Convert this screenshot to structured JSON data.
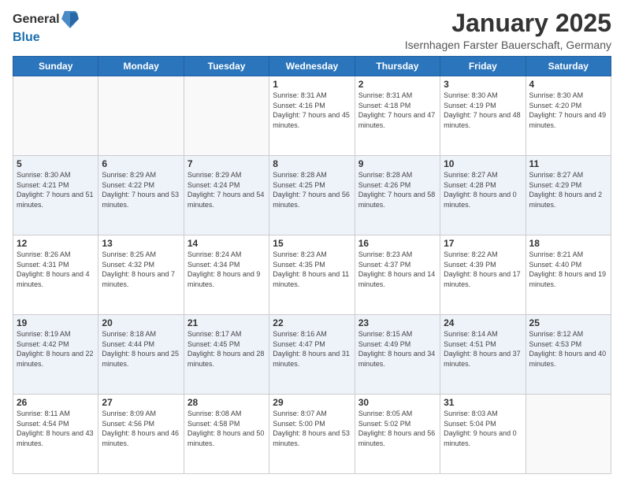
{
  "header": {
    "logo_general": "General",
    "logo_blue": "Blue",
    "month_title": "January 2025",
    "location": "Isernhagen Farster Bauerschaft, Germany"
  },
  "days_of_week": [
    "Sunday",
    "Monday",
    "Tuesday",
    "Wednesday",
    "Thursday",
    "Friday",
    "Saturday"
  ],
  "weeks": [
    [
      {
        "day": "",
        "info": ""
      },
      {
        "day": "",
        "info": ""
      },
      {
        "day": "",
        "info": ""
      },
      {
        "day": "1",
        "info": "Sunrise: 8:31 AM\nSunset: 4:16 PM\nDaylight: 7 hours and 45 minutes."
      },
      {
        "day": "2",
        "info": "Sunrise: 8:31 AM\nSunset: 4:18 PM\nDaylight: 7 hours and 47 minutes."
      },
      {
        "day": "3",
        "info": "Sunrise: 8:30 AM\nSunset: 4:19 PM\nDaylight: 7 hours and 48 minutes."
      },
      {
        "day": "4",
        "info": "Sunrise: 8:30 AM\nSunset: 4:20 PM\nDaylight: 7 hours and 49 minutes."
      }
    ],
    [
      {
        "day": "5",
        "info": "Sunrise: 8:30 AM\nSunset: 4:21 PM\nDaylight: 7 hours and 51 minutes."
      },
      {
        "day": "6",
        "info": "Sunrise: 8:29 AM\nSunset: 4:22 PM\nDaylight: 7 hours and 53 minutes."
      },
      {
        "day": "7",
        "info": "Sunrise: 8:29 AM\nSunset: 4:24 PM\nDaylight: 7 hours and 54 minutes."
      },
      {
        "day": "8",
        "info": "Sunrise: 8:28 AM\nSunset: 4:25 PM\nDaylight: 7 hours and 56 minutes."
      },
      {
        "day": "9",
        "info": "Sunrise: 8:28 AM\nSunset: 4:26 PM\nDaylight: 7 hours and 58 minutes."
      },
      {
        "day": "10",
        "info": "Sunrise: 8:27 AM\nSunset: 4:28 PM\nDaylight: 8 hours and 0 minutes."
      },
      {
        "day": "11",
        "info": "Sunrise: 8:27 AM\nSunset: 4:29 PM\nDaylight: 8 hours and 2 minutes."
      }
    ],
    [
      {
        "day": "12",
        "info": "Sunrise: 8:26 AM\nSunset: 4:31 PM\nDaylight: 8 hours and 4 minutes."
      },
      {
        "day": "13",
        "info": "Sunrise: 8:25 AM\nSunset: 4:32 PM\nDaylight: 8 hours and 7 minutes."
      },
      {
        "day": "14",
        "info": "Sunrise: 8:24 AM\nSunset: 4:34 PM\nDaylight: 8 hours and 9 minutes."
      },
      {
        "day": "15",
        "info": "Sunrise: 8:23 AM\nSunset: 4:35 PM\nDaylight: 8 hours and 11 minutes."
      },
      {
        "day": "16",
        "info": "Sunrise: 8:23 AM\nSunset: 4:37 PM\nDaylight: 8 hours and 14 minutes."
      },
      {
        "day": "17",
        "info": "Sunrise: 8:22 AM\nSunset: 4:39 PM\nDaylight: 8 hours and 17 minutes."
      },
      {
        "day": "18",
        "info": "Sunrise: 8:21 AM\nSunset: 4:40 PM\nDaylight: 8 hours and 19 minutes."
      }
    ],
    [
      {
        "day": "19",
        "info": "Sunrise: 8:19 AM\nSunset: 4:42 PM\nDaylight: 8 hours and 22 minutes."
      },
      {
        "day": "20",
        "info": "Sunrise: 8:18 AM\nSunset: 4:44 PM\nDaylight: 8 hours and 25 minutes."
      },
      {
        "day": "21",
        "info": "Sunrise: 8:17 AM\nSunset: 4:45 PM\nDaylight: 8 hours and 28 minutes."
      },
      {
        "day": "22",
        "info": "Sunrise: 8:16 AM\nSunset: 4:47 PM\nDaylight: 8 hours and 31 minutes."
      },
      {
        "day": "23",
        "info": "Sunrise: 8:15 AM\nSunset: 4:49 PM\nDaylight: 8 hours and 34 minutes."
      },
      {
        "day": "24",
        "info": "Sunrise: 8:14 AM\nSunset: 4:51 PM\nDaylight: 8 hours and 37 minutes."
      },
      {
        "day": "25",
        "info": "Sunrise: 8:12 AM\nSunset: 4:53 PM\nDaylight: 8 hours and 40 minutes."
      }
    ],
    [
      {
        "day": "26",
        "info": "Sunrise: 8:11 AM\nSunset: 4:54 PM\nDaylight: 8 hours and 43 minutes."
      },
      {
        "day": "27",
        "info": "Sunrise: 8:09 AM\nSunset: 4:56 PM\nDaylight: 8 hours and 46 minutes."
      },
      {
        "day": "28",
        "info": "Sunrise: 8:08 AM\nSunset: 4:58 PM\nDaylight: 8 hours and 50 minutes."
      },
      {
        "day": "29",
        "info": "Sunrise: 8:07 AM\nSunset: 5:00 PM\nDaylight: 8 hours and 53 minutes."
      },
      {
        "day": "30",
        "info": "Sunrise: 8:05 AM\nSunset: 5:02 PM\nDaylight: 8 hours and 56 minutes."
      },
      {
        "day": "31",
        "info": "Sunrise: 8:03 AM\nSunset: 5:04 PM\nDaylight: 9 hours and 0 minutes."
      },
      {
        "day": "",
        "info": ""
      }
    ]
  ]
}
